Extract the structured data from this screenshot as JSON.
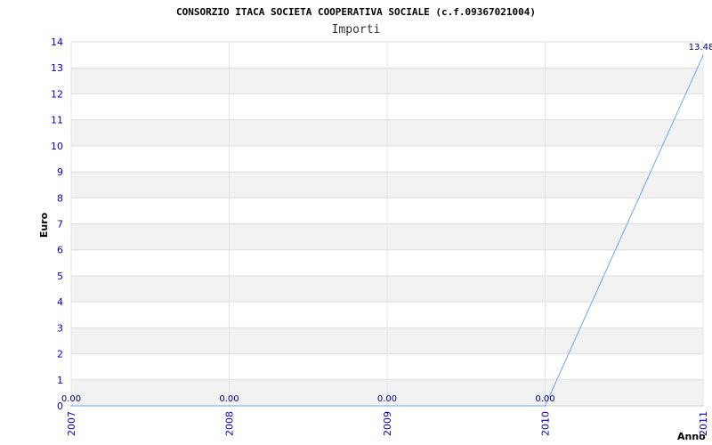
{
  "chart_data": {
    "type": "line",
    "title": "CONSORZIO ITACA SOCIETA COOPERATIVA SOCIALE (c.f.09367021004)",
    "subtitle": "Importi",
    "xlabel": "Anno",
    "ylabel": "Euro",
    "x": [
      "2007",
      "2008",
      "2009",
      "2010",
      "2011"
    ],
    "series": [
      {
        "values": [
          0.0,
          0.0,
          0.0,
          0.0,
          13.48
        ],
        "labels": [
          "0.00",
          "0.00",
          "0.00",
          "0.00",
          "13.48"
        ]
      }
    ],
    "ylim": [
      0,
      14
    ],
    "yticks": [
      "0",
      "1",
      "2",
      "3",
      "4",
      "5",
      "6",
      "7",
      "8",
      "9",
      "10",
      "11",
      "12",
      "13",
      "14"
    ],
    "grid": true,
    "legend": "none",
    "colors": {
      "line": "#6aa8f0",
      "band_light": "#f2f2f2",
      "band_white": "#ffffff",
      "gridline": "#dddddd",
      "tick_text": "#0000cc",
      "data_label": "#000080"
    }
  }
}
